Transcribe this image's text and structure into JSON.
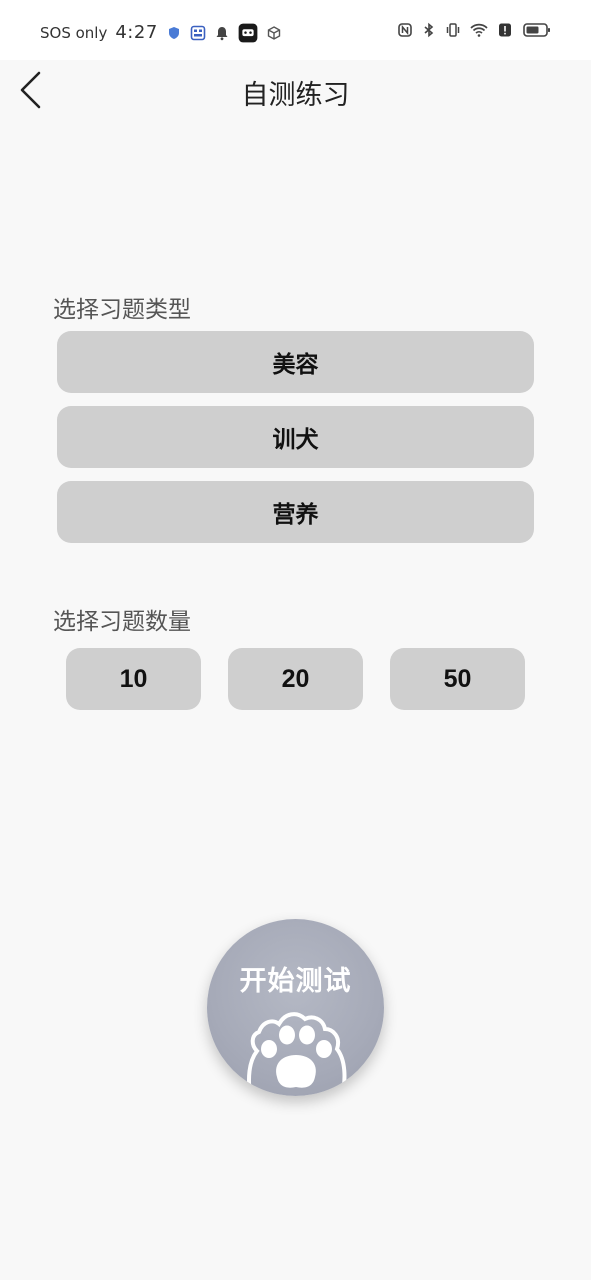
{
  "status_bar": {
    "carrier": "SOS only",
    "time": "4:27"
  },
  "nav": {
    "title": "自测练习",
    "back_icon": "chevron-left-icon"
  },
  "type_section": {
    "label": "选择习题类型",
    "options": [
      "美容",
      "训犬",
      "营养"
    ]
  },
  "count_section": {
    "label": "选择习题数量",
    "options": [
      "10",
      "20",
      "50"
    ]
  },
  "start": {
    "label": "开始测试",
    "icon": "paw-icon"
  },
  "colors": {
    "background": "#f8f8f8",
    "option_bg": "#cfcfcf",
    "start_bg": "#a6aab8"
  }
}
